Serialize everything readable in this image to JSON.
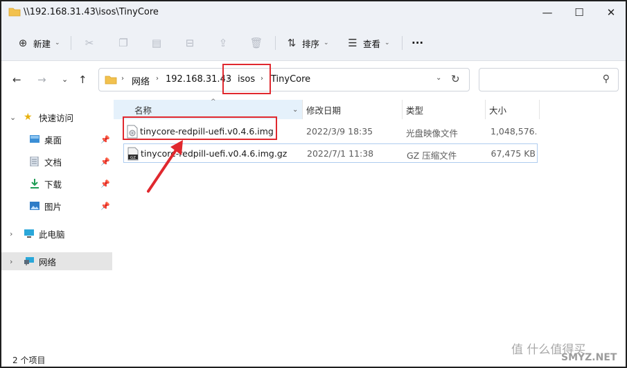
{
  "window": {
    "title": "\\\\192.168.31.43\\isos\\TinyCore",
    "minimize": "—",
    "maximize": "☐",
    "close": "✕"
  },
  "toolbar": {
    "new_label": "新建",
    "sort_label": "排序",
    "view_label": "查看",
    "more_label": "···"
  },
  "address": {
    "crumbs": [
      "网络",
      "192.168.31.43",
      "isos",
      "TinyCore"
    ]
  },
  "sidebar": {
    "items": [
      {
        "label": "快速访问",
        "icon": "star-icon",
        "expander": "⌄"
      },
      {
        "label": "桌面",
        "icon": "desktop-icon"
      },
      {
        "label": "文档",
        "icon": "documents-icon"
      },
      {
        "label": "下载",
        "icon": "download-icon"
      },
      {
        "label": "图片",
        "icon": "pictures-icon"
      },
      {
        "label": "此电脑",
        "icon": "computer-icon",
        "expander": "›"
      },
      {
        "label": "网络",
        "icon": "network-icon",
        "expander": "›"
      }
    ]
  },
  "columns": {
    "name": "名称",
    "modified": "修改日期",
    "type": "类型",
    "size": "大小"
  },
  "files": [
    {
      "name": "tinycore-redpill-uefi.v0.4.6.img",
      "modified": "2022/3/9 18:35",
      "type": "光盘映像文件",
      "size": "1,048,576..."
    },
    {
      "name": "tinycore-redpill-uefi.v0.4.6.img.gz",
      "modified": "2022/7/1 11:38",
      "type": "GZ 压缩文件",
      "size": "67,475 KB"
    }
  ],
  "gz_badge": "GZ",
  "status": {
    "count": "2 个项目"
  },
  "watermark": {
    "line1": "值 什么值得买",
    "line2": "SMYZ.NET"
  },
  "colors": {
    "annotation": "#e0282e",
    "selection": "#e5f1fb"
  }
}
